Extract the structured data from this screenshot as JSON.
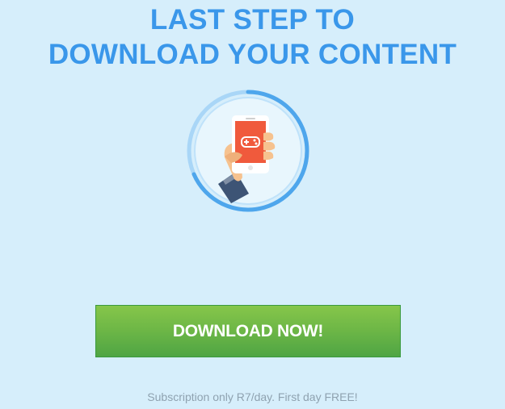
{
  "headline": {
    "line1": "LAST STEP TO",
    "line2": "DOWNLOAD YOUR CONTENT"
  },
  "illustration": {
    "icon": "hand-holding-phone-gamepad-icon"
  },
  "cta": {
    "label": "DOWNLOAD NOW!"
  },
  "footer": {
    "subscription_text": "Subscription only R7/day. First day FREE!"
  },
  "colors": {
    "background": "#d6eefb",
    "headline": "#3a97ea",
    "button_green": "#6cb646",
    "phone_red": "#f05a3c",
    "footer_text": "#8fa2b0"
  }
}
